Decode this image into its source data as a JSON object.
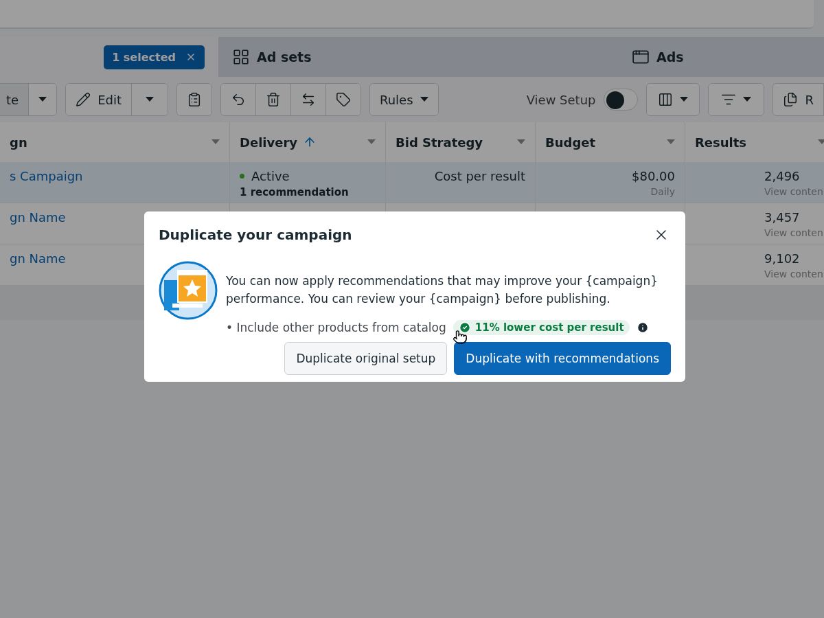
{
  "tabs": [
    {
      "kind": "selection",
      "badge": "1 selected",
      "selected": true
    },
    {
      "kind": "level",
      "label": "Ad sets",
      "selected": false
    },
    {
      "kind": "level",
      "label": "Ads",
      "selected": false
    }
  ],
  "toolbar": {
    "create_label": "te",
    "edit_label": "Edit",
    "rules_label": "Rules",
    "view_setup": {
      "label": "View Setup",
      "on": false
    },
    "reports_label": "R"
  },
  "table": {
    "columns": [
      {
        "label": "gn",
        "sorted": false
      },
      {
        "label": "Delivery",
        "sorted": true
      },
      {
        "label": "Bid Strategy",
        "sorted": false
      },
      {
        "label": "Budget",
        "sorted": false
      },
      {
        "label": "Results",
        "sorted": false
      }
    ],
    "rows": [
      {
        "selected": true,
        "name": "s Campaign",
        "delivery": {
          "status": "Active",
          "note": "1 recommendation"
        },
        "bid": "Cost per result",
        "budget": "$80.00",
        "budget_note": "Daily",
        "results": "2,496",
        "results_note": "View conten"
      },
      {
        "selected": false,
        "name": "gn Name",
        "results": "3,457",
        "results_note": "View conten"
      },
      {
        "selected": false,
        "name": "gn Name",
        "results": "9,102",
        "results_note": "View conten"
      }
    ]
  },
  "dialog": {
    "title": "Duplicate your campaign",
    "message": "You can now apply recommendations that may improve your {campaign} performance. You can review your {campaign} before publishing.",
    "bullet": "• Include other products from catalog",
    "badge": "11% lower cost per result",
    "buttons": [
      {
        "label": "Duplicate original setup",
        "kind": "secondary"
      },
      {
        "label": "Duplicate with recommendations",
        "kind": "primary"
      }
    ]
  }
}
